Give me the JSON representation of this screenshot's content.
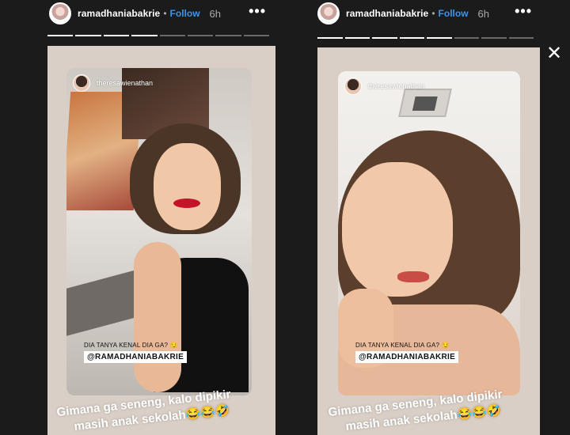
{
  "stories": [
    {
      "username": "ramadhaniabakrie",
      "separator": "•",
      "follow_label": "Follow",
      "time": "6h",
      "more_label": "•••",
      "progress_segments": 8,
      "progress_done": 4,
      "frame_username": "theresawienathan",
      "question": "DIA TANYA KENAL DIA GA? 😏",
      "mention": "@RAMADHANIABAKRIE",
      "caption_line1": "Gimana ga seneng, kalo dipikir",
      "caption_line2": "masih anak sekolah😂😂🤣"
    },
    {
      "username": "ramadhaniabakrie",
      "separator": "•",
      "follow_label": "Follow",
      "time": "6h",
      "more_label": "•••",
      "progress_segments": 8,
      "progress_done": 5,
      "frame_username": "theresawienathan",
      "question": "DIA TANYA KENAL DIA GA? 😏",
      "mention": "@RAMADHANIABAKRIE",
      "caption_line1": "Gimana ga seneng, kalo dipikir",
      "caption_line2": "masih anak sekolah😂😂🤣"
    }
  ],
  "close_label": "✕"
}
